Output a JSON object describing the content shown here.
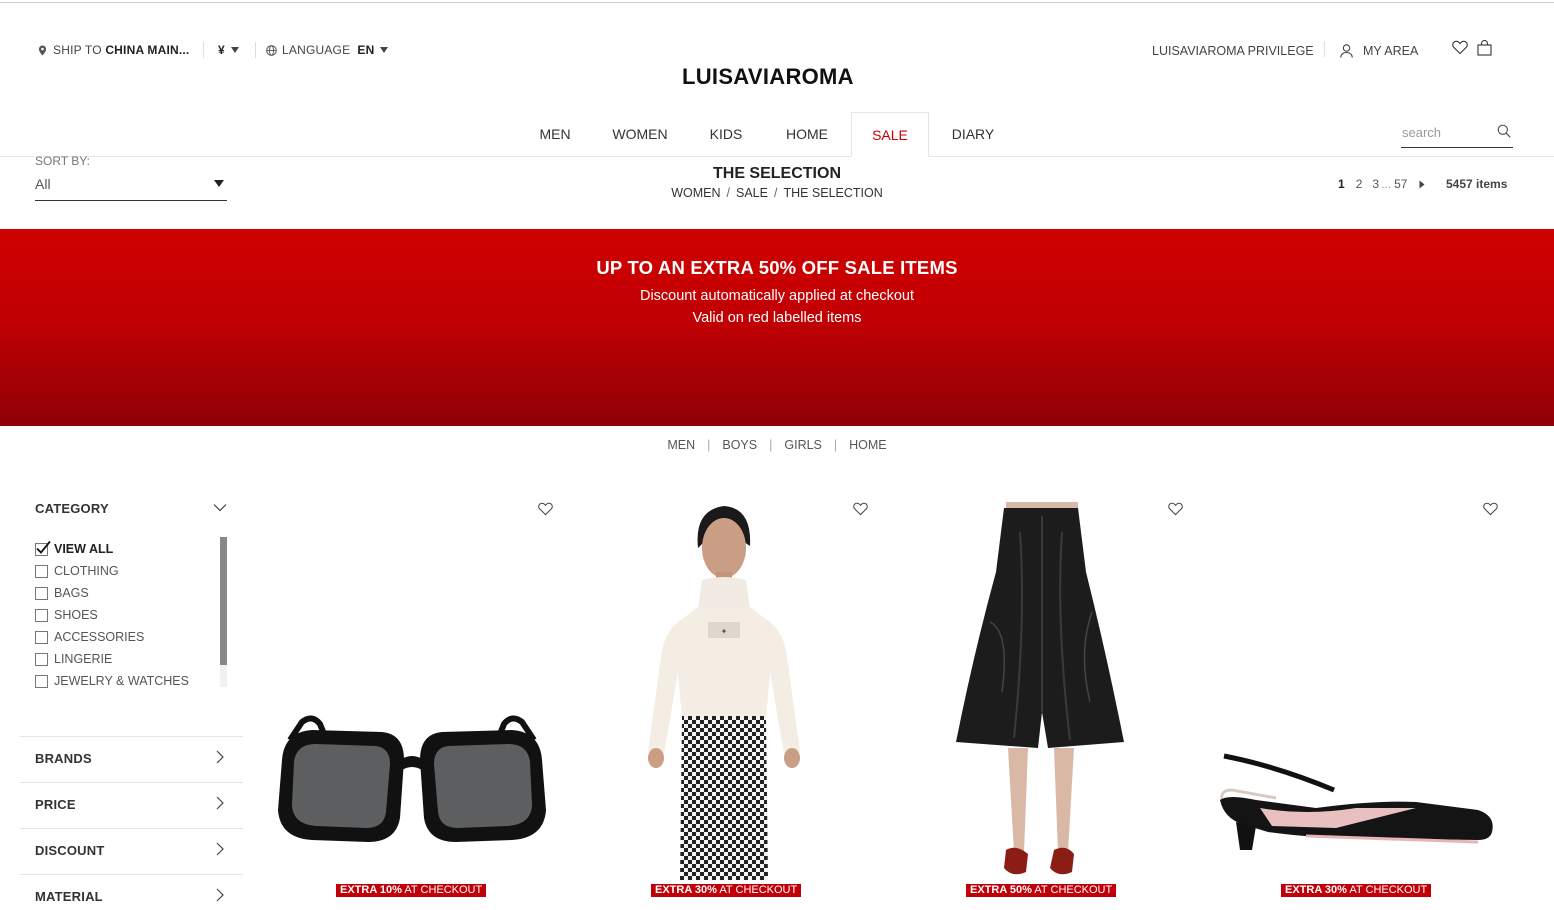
{
  "header": {
    "ship_label": "SHIP TO",
    "ship_value": "CHINA MAIN...",
    "currency": "¥",
    "language_label": "LANGUAGE",
    "language_value": "EN",
    "logo": "LUISAVIAROMA",
    "privilege": "LUISAVIAROMA PRIVILEGE",
    "my_area": "MY AREA"
  },
  "nav": {
    "items": [
      "MEN",
      "WOMEN",
      "KIDS",
      "HOME",
      "SALE",
      "DIARY"
    ],
    "active": "SALE",
    "search_placeholder": "search"
  },
  "listing": {
    "sort_label": "SORT BY:",
    "sort_value": "All",
    "title": "THE SELECTION",
    "breadcrumb": [
      "WOMEN",
      "SALE",
      "THE SELECTION"
    ],
    "pages": [
      "1",
      "2",
      "3",
      "...",
      "57"
    ],
    "current_page": "1",
    "items_count": "5457 items"
  },
  "banner": {
    "headline": "UP TO AN EXTRA 50% OFF SALE ITEMS",
    "line1": "Discount automatically applied at checkout",
    "line2": "Valid on red labelled items",
    "color": "#c00008"
  },
  "subcategories": [
    "MEN",
    "BOYS",
    "GIRLS",
    "HOME"
  ],
  "filters": {
    "category_title": "CATEGORY",
    "categories": [
      {
        "label": "VIEW ALL",
        "checked": true
      },
      {
        "label": "CLOTHING",
        "checked": false
      },
      {
        "label": "BAGS",
        "checked": false
      },
      {
        "label": "SHOES",
        "checked": false
      },
      {
        "label": "ACCESSORIES",
        "checked": false
      },
      {
        "label": "LINGERIE",
        "checked": false
      },
      {
        "label": "JEWELRY & WATCHES",
        "checked": false
      }
    ],
    "sections": [
      "BRANDS",
      "PRICE",
      "DISCOUNT",
      "MATERIAL"
    ]
  },
  "products": [
    {
      "image": "sunglasses",
      "badge_strong": "EXTRA 10%",
      "badge_rest": " AT CHECKOUT"
    },
    {
      "image": "turtleneck-sweater-houndstooth-pants",
      "badge_strong": "EXTRA 30%",
      "badge_rest": " AT CHECKOUT"
    },
    {
      "image": "leather-midi-skirt",
      "badge_strong": "EXTRA 50%",
      "badge_rest": " AT CHECKOUT"
    },
    {
      "image": "slingback-pump",
      "badge_strong": "EXTRA 30%",
      "badge_rest": " AT CHECKOUT"
    }
  ]
}
